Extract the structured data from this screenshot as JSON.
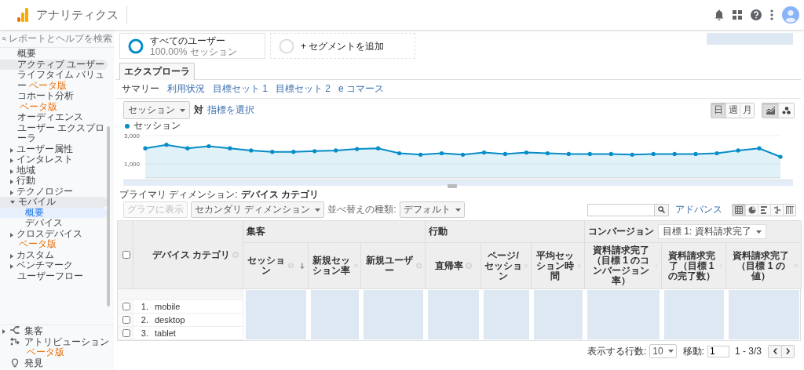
{
  "app": {
    "title": "アナリティクス"
  },
  "sidebar": {
    "search": {
      "placeholder": "レポートとヘルプを検索"
    },
    "items": [
      {
        "label": "概要",
        "selected": false,
        "hovered": false
      },
      {
        "label": "アクティブ ユーザー",
        "selected": false,
        "hovered": true
      },
      {
        "label": "ライフタイム バリュー",
        "badge": "ベータ版",
        "selected": false,
        "hovered": false
      },
      {
        "label": "コホート分析",
        "badge": "ベータ版",
        "selected": false,
        "hovered": false
      },
      {
        "label": "オーディエンス",
        "selected": false,
        "hovered": false
      },
      {
        "label": "ユーザー エクスプローラ",
        "selected": false,
        "hovered": false
      },
      {
        "label": "ユーザー属性",
        "expanded": false,
        "selected": false,
        "hovered": false
      },
      {
        "label": "インタレスト",
        "expanded": false,
        "selected": false,
        "hovered": false
      },
      {
        "label": "地域",
        "expanded": false,
        "selected": false,
        "hovered": false
      },
      {
        "label": "行動",
        "expanded": false,
        "selected": false,
        "hovered": false
      },
      {
        "label": "テクノロジー",
        "expanded": false,
        "selected": false,
        "hovered": false
      },
      {
        "label": "モバイル",
        "expanded": true,
        "selected": false,
        "hovered": false,
        "children": [
          {
            "label": "概要",
            "selected": true
          },
          {
            "label": "デバイス",
            "selected": false
          }
        ]
      },
      {
        "label": "クロスデバイス",
        "badge": "ベータ版",
        "expanded": false,
        "selected": false,
        "hovered": false
      },
      {
        "label": "カスタム",
        "expanded": false,
        "selected": false,
        "hovered": false
      },
      {
        "label": "ベンチマーク",
        "expanded": false,
        "selected": false,
        "hovered": false
      },
      {
        "label": "ユーザーフロー",
        "selected": false,
        "hovered": false
      }
    ],
    "sections": [
      {
        "kind": "acquisition",
        "label": "集客",
        "expanded": false
      },
      {
        "kind": "attribution",
        "label": "アトリビューション",
        "badge": "ベータ版"
      },
      {
        "kind": "discover",
        "label": "発見"
      }
    ]
  },
  "segments": [
    {
      "kind": "active",
      "label": "すべてのユーザー",
      "sublabel": "100.00% セッション"
    },
    {
      "kind": "add",
      "label": "+ セグメントを追加"
    }
  ],
  "explorer": {
    "tab": "エクスプローラ",
    "sub_tabs": [
      {
        "label": "サマリー",
        "selected": true
      },
      {
        "label": "利用状況",
        "selected": false
      },
      {
        "label": "目標セット 1",
        "selected": false
      },
      {
        "label": "目標セット 2",
        "selected": false
      },
      {
        "label": "e コマース",
        "selected": false
      }
    ],
    "metric": "セッション",
    "versus": "対",
    "metric_link": "指標を選択",
    "intervals": [
      {
        "label": "日",
        "selected": true
      },
      {
        "label": "週",
        "selected": false
      },
      {
        "label": "月",
        "selected": false
      }
    ],
    "chart_types": [
      {
        "kind": "line",
        "selected": true
      },
      {
        "kind": "motion",
        "selected": false
      }
    ],
    "chart_data": {
      "type": "area",
      "ylim": [
        0,
        3000
      ],
      "yticks": [
        {
          "value": 1000,
          "label": "1,000"
        },
        {
          "value": 3000,
          "label": "3,000"
        }
      ],
      "series": [
        {
          "name": "セッション",
          "color": "#058dc7",
          "values": [
            2100,
            2350,
            2100,
            2250,
            2100,
            1950,
            1850,
            1850,
            1900,
            1950,
            2050,
            2100,
            1750,
            1650,
            1750,
            1650,
            1800,
            1700,
            1800,
            1750,
            1700,
            1700,
            1700,
            1650,
            1700,
            1700,
            1700,
            1750,
            1950,
            2100,
            1500
          ]
        }
      ]
    }
  },
  "primary_dimension": {
    "label": "プライマリ ディメンション:",
    "value": "デバイス カテゴリ"
  },
  "toolbar": {
    "plot_button": {
      "label": "グラフに表示",
      "disabled": true
    },
    "secondary_dimension": "セカンダリ ディメンション",
    "sort_label": "並べ替えの種類:",
    "sort_value": "デフォルト",
    "advanced": "アドバンス",
    "views": [
      {
        "kind": "table",
        "selected": true
      },
      {
        "kind": "pie",
        "selected": false
      },
      {
        "kind": "performance",
        "selected": false
      },
      {
        "kind": "comparison",
        "selected": false
      },
      {
        "kind": "pivot",
        "selected": false
      }
    ]
  },
  "table": {
    "select_all": {
      "checked": false
    },
    "dimension": "デバイス カテゴリ",
    "groups": [
      {
        "label": "集客",
        "columns": [
          "セッション",
          "新規セッション率",
          "新規ユーザー"
        ]
      },
      {
        "label": "行動",
        "columns": [
          "直帰率",
          "ページ/セッション",
          "平均セッション時間"
        ]
      },
      {
        "label": "コンバージョン",
        "goal_select": "目標 1: 資料請求完了",
        "columns": [
          "資料請求完了（目標 1 のコンバージョン率）",
          "資料請求完了（目標 1 の完了数）",
          "資料請求完了（目標 1 の値）"
        ]
      }
    ],
    "rows": [
      {
        "index": "1.",
        "label": "mobile",
        "checked": false
      },
      {
        "index": "2.",
        "label": "desktop",
        "checked": false
      },
      {
        "index": "3.",
        "label": "tablet",
        "checked": false
      }
    ]
  },
  "pagination": {
    "rows_label": "表示する行数:",
    "rows_value": "10",
    "goto_label": "移動:",
    "goto_value": "1",
    "range": "1 - 3/3"
  }
}
